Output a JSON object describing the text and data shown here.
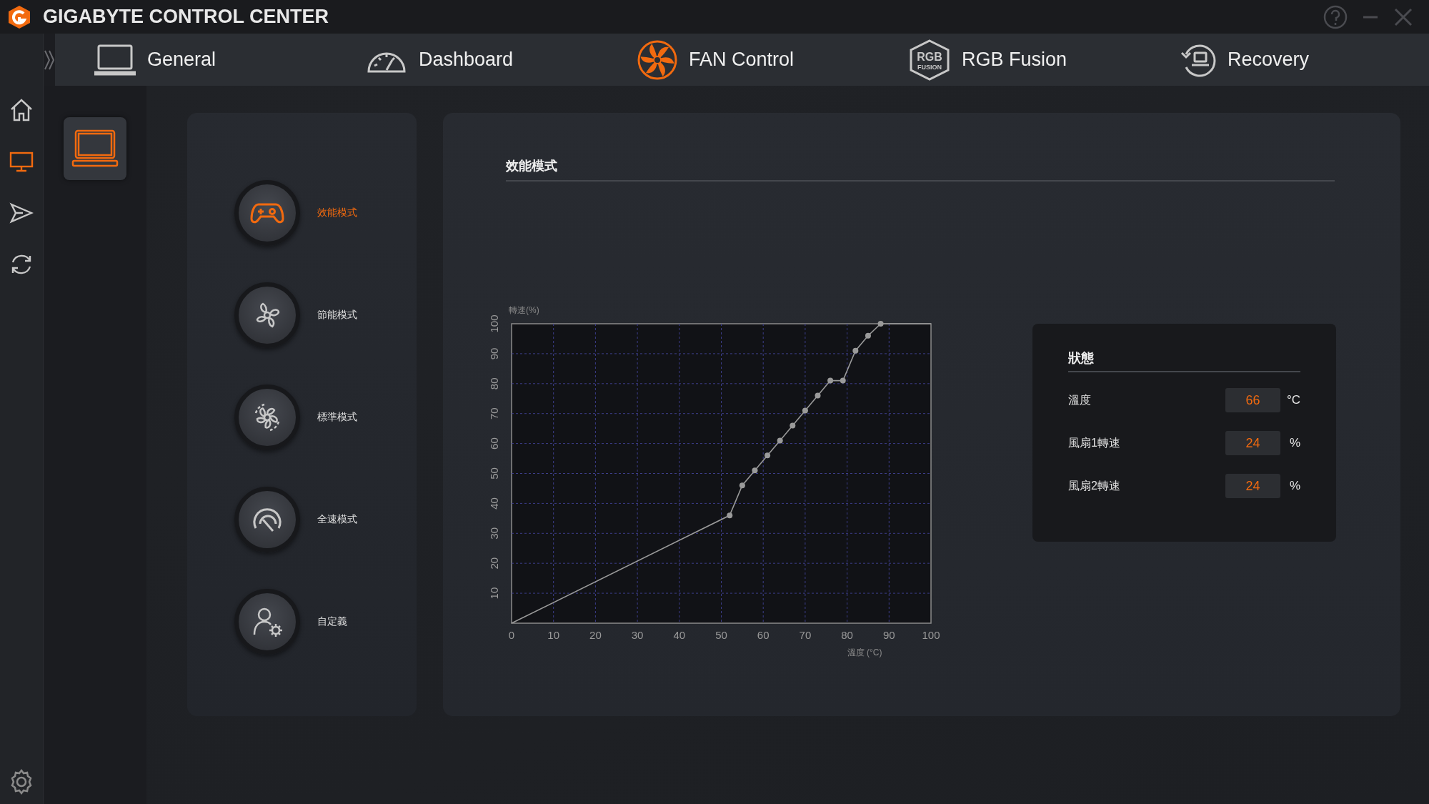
{
  "window": {
    "title": "GIGABYTE CONTROL CENTER"
  },
  "tabs": [
    {
      "label": "General",
      "kind": "laptop",
      "selected": false
    },
    {
      "label": "Dashboard",
      "kind": "gauge",
      "selected": false
    },
    {
      "label": "FAN Control",
      "kind": "fan",
      "selected": true
    },
    {
      "label": "RGB Fusion",
      "kind": "rgb",
      "icon_text": [
        "RGB",
        "FUSION"
      ],
      "selected": false
    },
    {
      "label": "Recovery",
      "kind": "recovery",
      "selected": false
    }
  ],
  "sidebar": {
    "items": [
      {
        "kind": "home",
        "selected": false
      },
      {
        "kind": "monitor",
        "selected": true
      },
      {
        "kind": "send",
        "selected": false
      },
      {
        "kind": "sync",
        "selected": false
      }
    ]
  },
  "devices": [
    {
      "kind": "laptop",
      "selected": true
    }
  ],
  "modes": [
    {
      "label": "效能模式",
      "kind": "gamepad",
      "selected": true
    },
    {
      "label": "節能模式",
      "kind": "leaf-fan",
      "selected": false
    },
    {
      "label": "標準模式",
      "kind": "fan",
      "selected": false
    },
    {
      "label": "全速模式",
      "kind": "speed",
      "selected": false
    },
    {
      "label": "自定義",
      "kind": "user",
      "selected": false
    }
  ],
  "curve_panel": {
    "title": "效能模式",
    "chart_data": {
      "type": "line",
      "xlabel": "溫度 (°C)",
      "ylabel": "轉速(%)",
      "x": [
        0,
        52,
        55,
        58,
        61,
        64,
        67,
        70,
        73,
        76,
        79,
        82,
        85,
        88,
        100
      ],
      "grid": true,
      "series": [
        {
          "color": "#9a9a9a",
          "marker": true,
          "values": [
            0,
            36,
            46,
            51,
            56,
            61,
            66,
            71,
            76,
            81,
            81,
            91,
            96,
            100,
            100
          ]
        }
      ],
      "xlim": [
        0,
        100
      ],
      "ylim": [
        0,
        100
      ],
      "xticks": [
        0,
        10,
        20,
        30,
        40,
        50,
        60,
        70,
        80,
        90,
        100
      ],
      "yticks": [
        10,
        20,
        30,
        40,
        50,
        60,
        70,
        80,
        90,
        100
      ]
    }
  },
  "status": {
    "title": "狀態",
    "rows": [
      {
        "label": "溫度",
        "value": "66",
        "unit": "°C"
      },
      {
        "label": "風扇1轉速",
        "value": "24",
        "unit": "%"
      },
      {
        "label": "風扇2轉速",
        "value": "24",
        "unit": "%"
      }
    ]
  }
}
